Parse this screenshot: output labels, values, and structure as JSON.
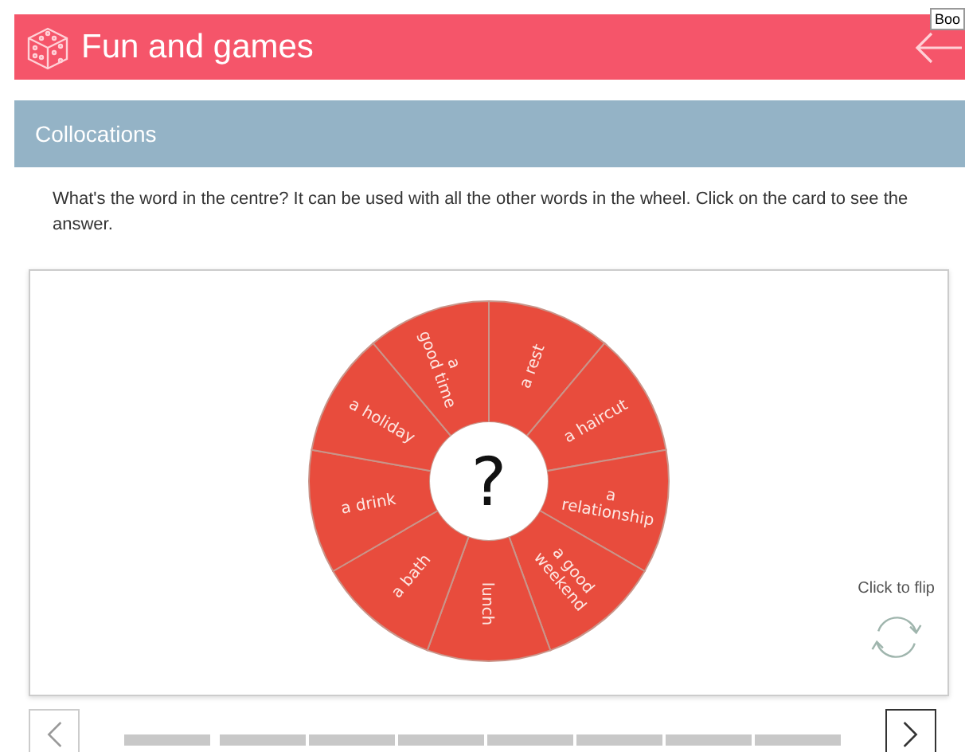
{
  "header": {
    "title": "Fun and games",
    "tooltip": "Boo"
  },
  "section": {
    "title": "Collocations"
  },
  "instructions": "What's the word in the centre? It can be used with all the other words in the wheel. Click on the card to see the answer.",
  "card": {
    "centre": "?",
    "flip_hint": "Click to flip",
    "segments": [
      {
        "lines": [
          "a rest"
        ]
      },
      {
        "lines": [
          "a haircut"
        ]
      },
      {
        "lines": [
          "a",
          "relationship"
        ]
      },
      {
        "lines": [
          "a good",
          "weekend"
        ]
      },
      {
        "lines": [
          "lunch"
        ]
      },
      {
        "lines": [
          "a bath"
        ]
      },
      {
        "lines": [
          "a drink"
        ]
      },
      {
        "lines": [
          "a holiday"
        ]
      },
      {
        "lines": [
          "a",
          "good time"
        ]
      }
    ]
  }
}
